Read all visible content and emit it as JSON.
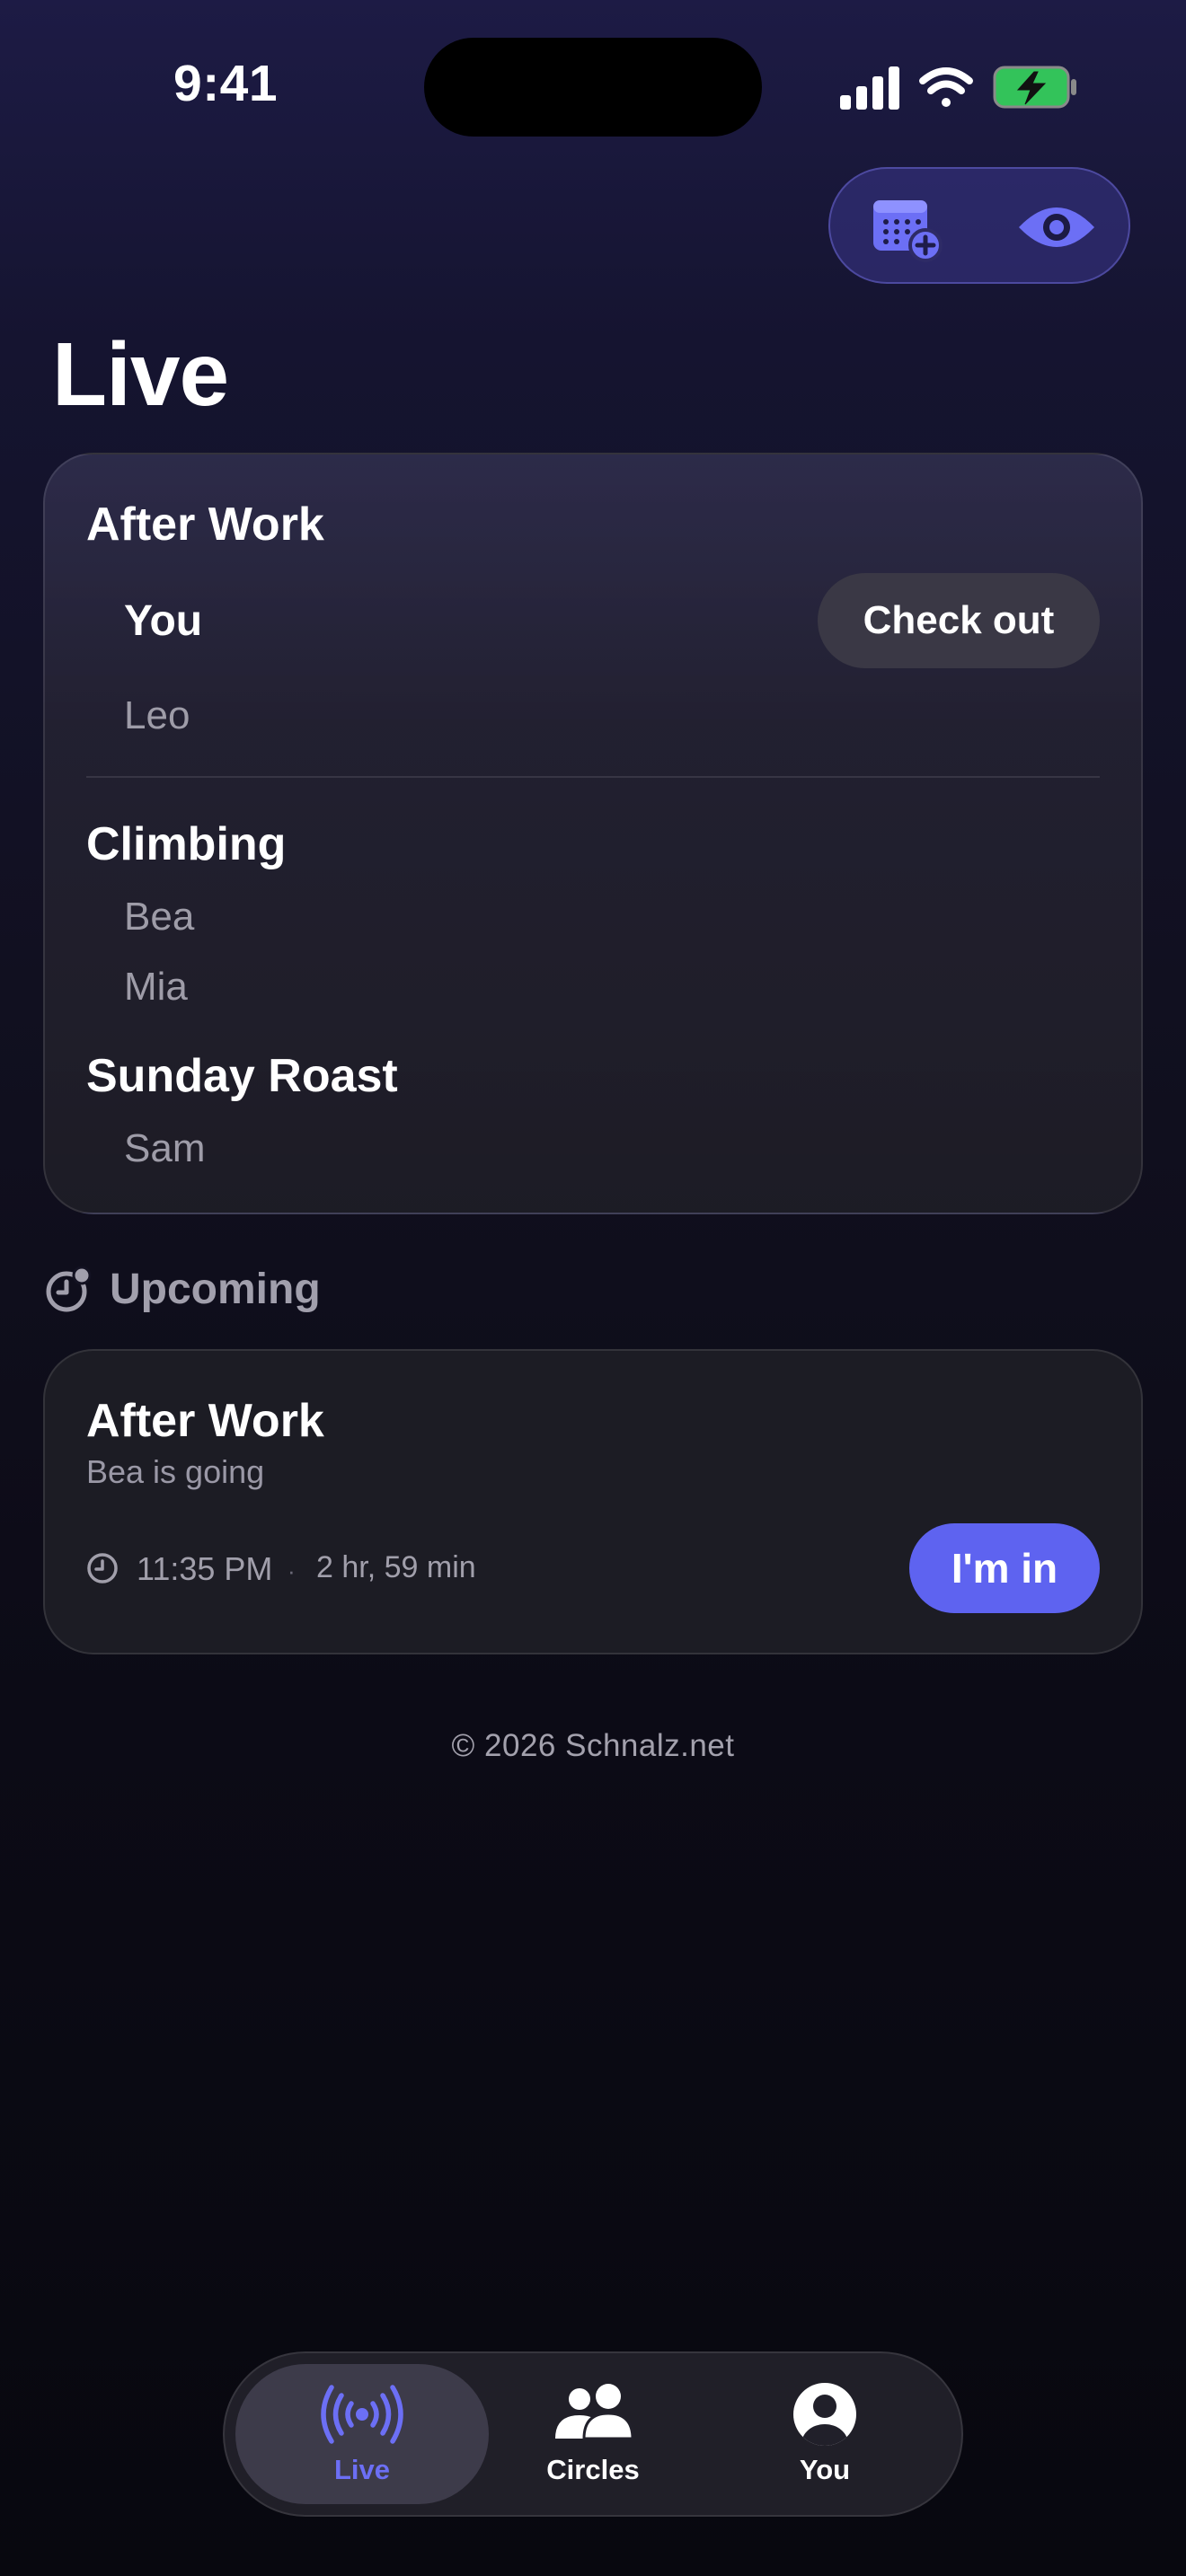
{
  "status_bar": {
    "time": "9:41"
  },
  "top_actions": {
    "icons": [
      "calendar-add-icon",
      "eye-icon"
    ],
    "accent_color": "#6c6ff5"
  },
  "page": {
    "title": "Live"
  },
  "live_groups": [
    {
      "name": "After Work",
      "members": [
        "You",
        "Leo"
      ],
      "action_label": "Check out"
    },
    {
      "name": "Climbing",
      "members": [
        "Bea",
        "Mia"
      ]
    },
    {
      "name": "Sunday Roast",
      "members": [
        "Sam"
      ]
    }
  ],
  "upcoming": {
    "section_label": "Upcoming",
    "icon": "clock-badge-icon",
    "events": [
      {
        "title": "After Work",
        "subtitle": "Bea is going",
        "time": "11:35 PM",
        "separator": "·",
        "duration": "2 hr, 59 min",
        "action_label": "I'm in",
        "action_color": "#5e63f0"
      }
    ]
  },
  "footer": {
    "text": "© 2026 Schnalz.net"
  },
  "tab_bar": {
    "active": "Live",
    "active_color": "#6c6ff5",
    "tabs": [
      {
        "label": "Live",
        "icon": "broadcast-icon"
      },
      {
        "label": "Circles",
        "icon": "people-icon"
      },
      {
        "label": "You",
        "icon": "person-circle-icon"
      }
    ]
  }
}
